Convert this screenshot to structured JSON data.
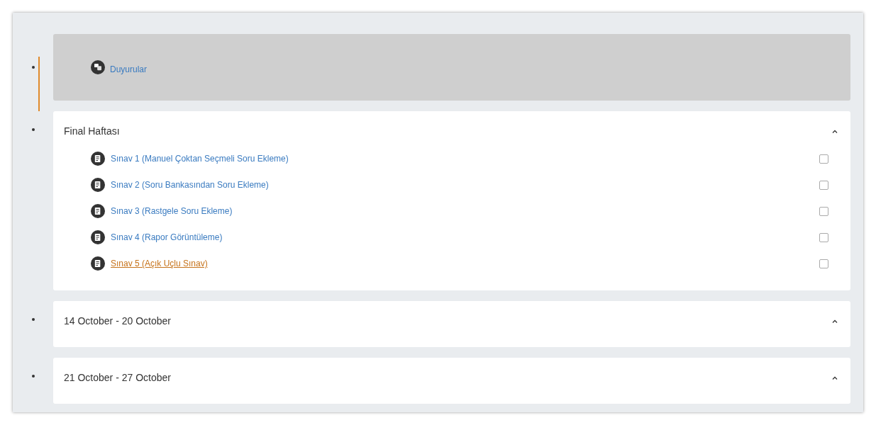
{
  "sections": [
    {
      "kind": "announcements",
      "current": true,
      "items": [
        {
          "title": "Duyurular"
        }
      ]
    },
    {
      "kind": "week",
      "title": "Final Haftası",
      "expanded": true,
      "items": [
        {
          "title": "Sınav 1 (Manuel Çoktan Seçmeli Soru Ekleme)",
          "checked": false,
          "hovered": false
        },
        {
          "title": "Sınav 2 (Soru Bankasından Soru Ekleme)",
          "checked": false,
          "hovered": false
        },
        {
          "title": "Sınav 3 (Rastgele Soru Ekleme)",
          "checked": false,
          "hovered": false
        },
        {
          "title": "Sınav 4 (Rapor Görüntüleme)",
          "checked": false,
          "hovered": false
        },
        {
          "title": "Sınav 5 (Açık Uçlu Sınav)",
          "checked": false,
          "hovered": true
        }
      ]
    },
    {
      "kind": "week",
      "title": "14 October - 20 October",
      "expanded": true
    },
    {
      "kind": "week",
      "title": "21 October - 27 October",
      "expanded": true
    }
  ]
}
